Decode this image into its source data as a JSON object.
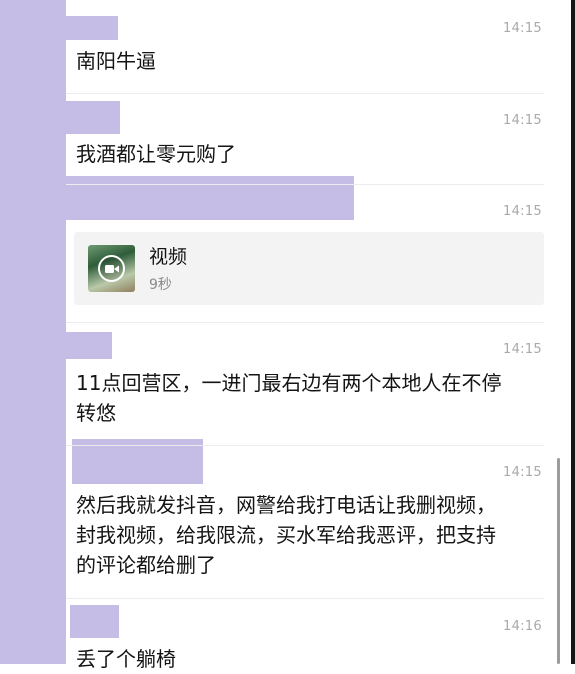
{
  "messages": [
    {
      "time": "14:15",
      "text": "南阳牛逼"
    },
    {
      "time": "14:15",
      "text": "我酒都让零元购了"
    },
    {
      "time": "14:15",
      "video": {
        "title": "视频",
        "duration": "9秒",
        "icon": "video-camera-icon"
      }
    },
    {
      "time": "14:15",
      "text": "11点回营区，一进门最右边有两个本地人在不停\n转悠"
    },
    {
      "time": "14:15",
      "text": "然后我就发抖音，网警给我打电话让我删视频，\n封我视频，给我限流，买水军给我恶评，把支持\n的评论都给删了"
    },
    {
      "time": "14:16",
      "text": "丢了个躺椅"
    }
  ],
  "colors": {
    "redaction": "#c5bde6",
    "divider": "#ececec",
    "timestamp": "#a9a9a9",
    "card_bg": "#f3f3f3"
  }
}
